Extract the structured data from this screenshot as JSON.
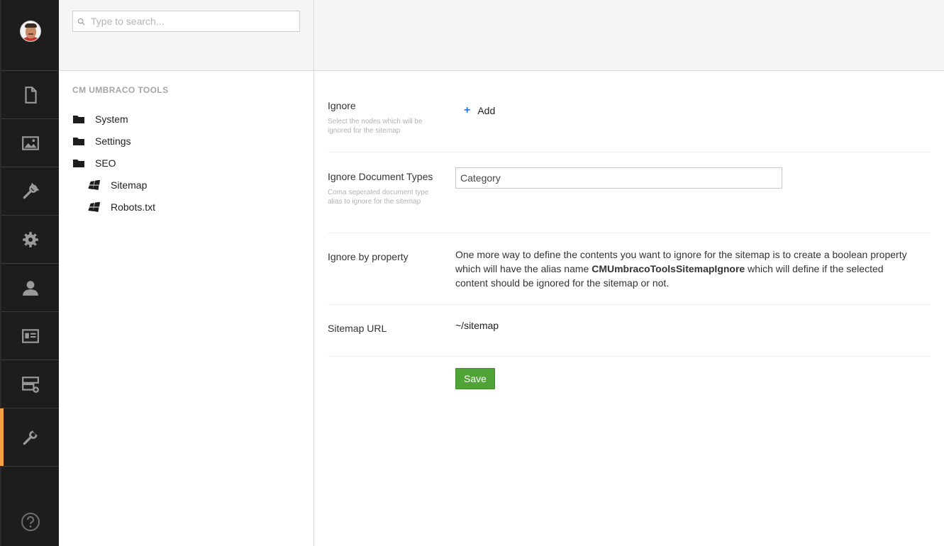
{
  "search": {
    "placeholder": "Type to search..."
  },
  "sidebar": {
    "sections": [
      {
        "icon": "document-icon"
      },
      {
        "icon": "media-icon"
      },
      {
        "icon": "wrench-icon"
      },
      {
        "icon": "gear-icon"
      },
      {
        "icon": "user-icon"
      },
      {
        "icon": "member-card-icon"
      },
      {
        "icon": "form-add-icon"
      },
      {
        "icon": "tools-icon",
        "active": true
      }
    ],
    "help_icon": "question-icon",
    "active_color": "#f5a045"
  },
  "tree": {
    "title": "CM UMBRACO TOOLS",
    "items": [
      {
        "label": "System",
        "icon": "folder-icon"
      },
      {
        "label": "Settings",
        "icon": "folder-icon"
      },
      {
        "label": "SEO",
        "icon": "folder-icon"
      },
      {
        "label": "Sitemap",
        "icon": "windows-icon"
      },
      {
        "label": "Robots.txt",
        "icon": "windows-icon"
      }
    ]
  },
  "form": {
    "ignore": {
      "label": "Ignore",
      "description": "Select the nodes which will be ignored for the sitemap",
      "add_label": "Add"
    },
    "ignore_doc_types": {
      "label": "Ignore Document Types",
      "description": "Coma seperated document type alias to ignore for the sitemap",
      "value": "Category"
    },
    "ignore_by_property": {
      "label": "Ignore by property",
      "text_before": "One more way to define the contents you want to ignore for the sitemap is to create a boolean property which will have the alias name ",
      "alias": "CMUmbracoToolsSitemapIgnore",
      "text_after": " which will define if the selected content should be ignored for the sitemap or not."
    },
    "sitemap_url": {
      "label": "Sitemap URL",
      "value": "~/sitemap"
    },
    "save_label": "Save",
    "save_color": "#50a435"
  }
}
